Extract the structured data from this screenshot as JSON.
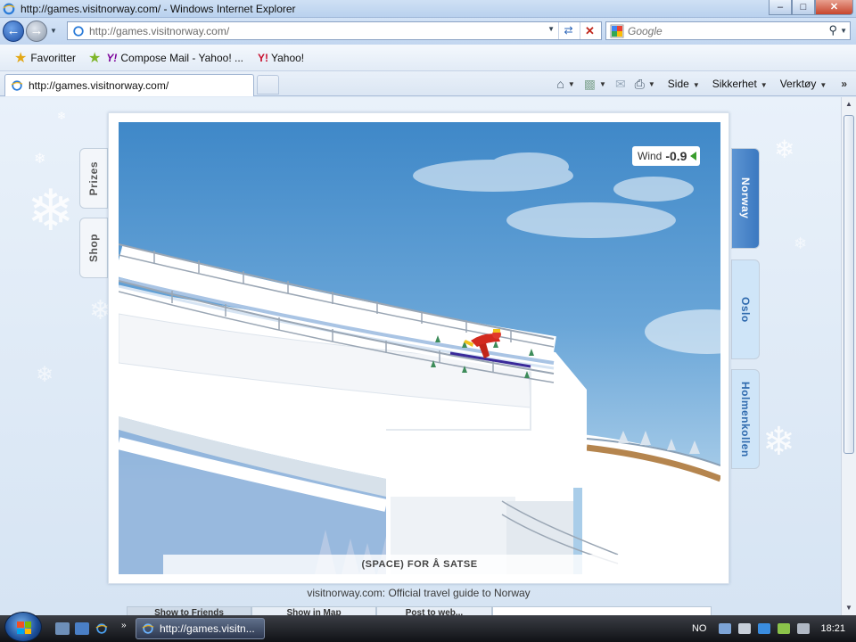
{
  "window": {
    "title": "http://games.visitnorway.com/ - Windows Internet Explorer"
  },
  "addressbar": {
    "url": "http://games.visitnorway.com/",
    "search_placeholder": "Google"
  },
  "favorites": {
    "label": "Favoritter",
    "items": [
      "Compose Mail - Yahoo! ...",
      "Yahoo!"
    ]
  },
  "tabs": {
    "active": "http://games.visitnorway.com/"
  },
  "commandbar": {
    "page": "Side",
    "safety": "Sikkerhet",
    "tools": "Verktøy"
  },
  "game": {
    "left_tabs": [
      "Prizes",
      "Shop"
    ],
    "right_tabs": [
      "Norway",
      "Oslo",
      "Holmenkollen"
    ],
    "active_right_tab": "Norway",
    "wind_label": "Wind",
    "wind_value": "-0.9",
    "hint": "(SPACE) FOR Å SATSE"
  },
  "footer": {
    "text": "visitnorway.com: Official travel guide to Norway",
    "tabs": [
      "Show to Friends",
      "Show in Map",
      "Post to web..."
    ]
  },
  "taskbar": {
    "task_label": "http://games.visitn...",
    "language": "NO",
    "clock": "18:21"
  },
  "colors": {
    "accent": "#3b78c0",
    "wind_arrow": "#3a9d2c"
  }
}
